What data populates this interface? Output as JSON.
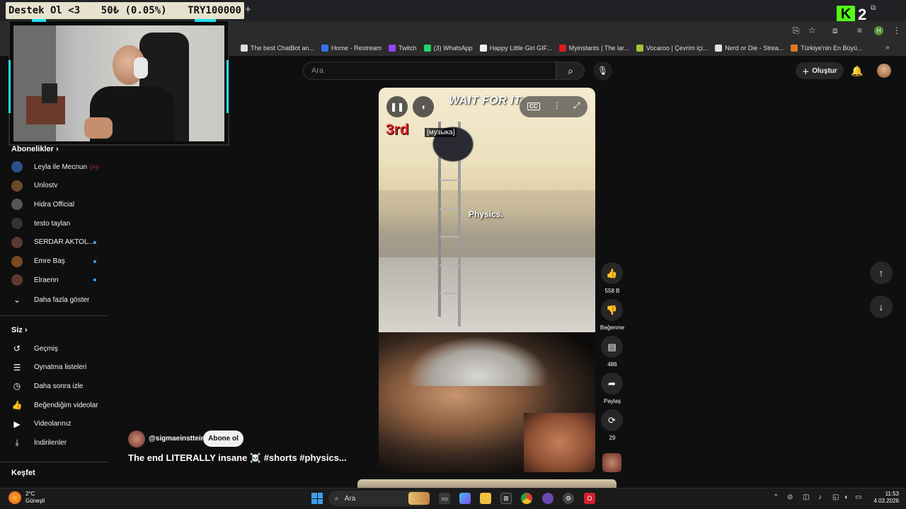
{
  "stream_banner": {
    "left": "Destek Ol <3",
    "middle": "50₺ (0.05%)",
    "right": "TRY100000"
  },
  "browser": {
    "new_tab": "+",
    "kick_number": "2",
    "kick_letter": "K",
    "profile_letter": "H",
    "bookmarks": [
      {
        "label": "The best ChatBot an...",
        "icon_color": "#dddddd"
      },
      {
        "label": "Home - Restream",
        "icon_color": "#3a6cf0"
      },
      {
        "label": "Twitch",
        "icon_color": "#9146ff"
      },
      {
        "label": "(3) WhatsApp",
        "icon_color": "#25d366"
      },
      {
        "label": "Happy Little Girl GIF...",
        "icon_color": "#f0f0f0"
      },
      {
        "label": "Myinstants | The lar...",
        "icon_color": "#d82020"
      },
      {
        "label": "Vocaroo | Çevrim içi...",
        "icon_color": "#9ac83a"
      },
      {
        "label": "Nerd or Die - Strea...",
        "icon_color": "#e0e0e0"
      },
      {
        "label": "Türkiye'nin En Büyü...",
        "icon_color": "#e07a20"
      }
    ]
  },
  "header": {
    "search_placeholder": "Ara",
    "create_label": "Oluştur"
  },
  "sidebar": {
    "subscriptions_title": "Abonelikler",
    "channels": [
      {
        "name": "Leyla ile Mecnun",
        "color": "#2d4f8a",
        "live": true
      },
      {
        "name": "Unlostv",
        "color": "#6b4a2a",
        "new": false
      },
      {
        "name": "Hidra Official",
        "color": "#555555",
        "new": false
      },
      {
        "name": "testo taylan",
        "color": "#333333",
        "new": false
      },
      {
        "name": "SERDAR AKTOL...",
        "color": "#5a3a30",
        "new": true
      },
      {
        "name": "Emre Baş",
        "color": "#7a4a20",
        "new": true
      },
      {
        "name": "Elraenn",
        "color": "#5a3a30",
        "new": true
      }
    ],
    "show_more": "Daha fazla göster",
    "you_title": "Siz",
    "you_items": [
      {
        "label": "Geçmiş",
        "icon": "history-icon"
      },
      {
        "label": "Oynatma listeleri",
        "icon": "playlist-icon"
      },
      {
        "label": "Daha sonra izle",
        "icon": "clock-icon"
      },
      {
        "label": "Beğendiğim videolar",
        "icon": "thumb-up-icon"
      },
      {
        "label": "Videolarınız",
        "icon": "video-icon"
      },
      {
        "label": "İndirilenler",
        "icon": "download-icon"
      }
    ],
    "explore_title": "Keşfet"
  },
  "short": {
    "overlay_title": "WAIT FOR IT",
    "rank_text": "3rd",
    "caption_tag": "[музыка]",
    "subtitle": "Physics.",
    "channel": "@sigmaeinsttein",
    "subscribe_label": "Abone ol",
    "title": "The end LITERALLY insane ☠️ #shorts #physics..."
  },
  "actions": {
    "likes": "558 B",
    "dislike_label": "Beğenme",
    "comments": "486",
    "share_label": "Paylaş",
    "remix_count": "29"
  },
  "taskbar": {
    "temp": "2°C",
    "weather": "Güneşli",
    "search_label": "Ara",
    "time": "11:53",
    "date": "4.03.2026"
  }
}
